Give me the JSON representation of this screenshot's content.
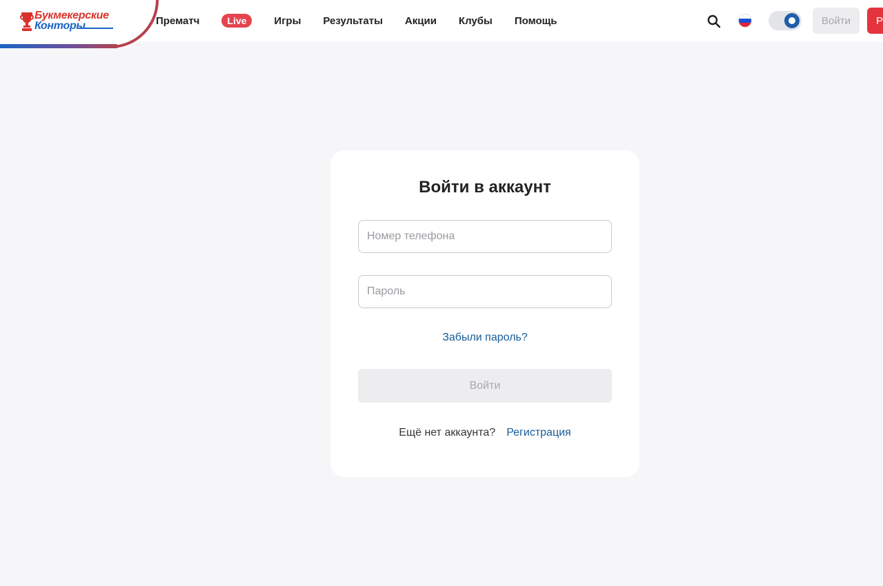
{
  "brand": {
    "logo_line1": "Букмекерские",
    "logo_line2": "Конторы",
    "arc_color": "#b3434e",
    "red": "#d9322c",
    "blue": "#1a64c4"
  },
  "nav": {
    "items": [
      {
        "label": "Прематч"
      },
      {
        "label": "Live",
        "badge": true
      },
      {
        "label": "Игры"
      },
      {
        "label": "Результаты"
      },
      {
        "label": "Акции"
      },
      {
        "label": "Клубы"
      },
      {
        "label": "Помощь"
      }
    ]
  },
  "header_actions": {
    "search_icon": "search-icon",
    "language_flag": "russia-flag-icon",
    "theme_toggle": "on",
    "login_label": "Войти",
    "register_label_visible": "Р"
  },
  "login_form": {
    "title": "Войти в аккаунт",
    "phone_placeholder": "Номер телефона",
    "phone_value": "",
    "password_placeholder": "Пароль",
    "password_value": "",
    "forgot_label": "Забыли пароль?",
    "submit_label": "Войти",
    "no_account_text": "Ещё нет аккаунта?",
    "register_label": "Регистрация"
  },
  "colors": {
    "accent": "#e4353f",
    "link": "#165c9a",
    "background": "#f6f6f8",
    "toggle_knob": "#1f5fa8"
  }
}
